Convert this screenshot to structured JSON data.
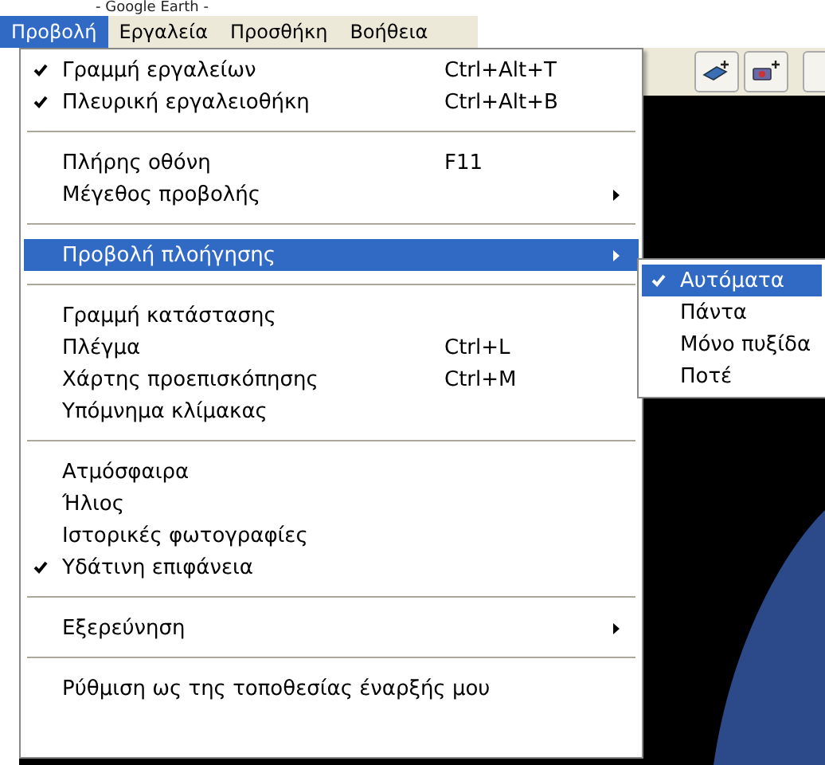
{
  "window": {
    "title": "- Google Earth -"
  },
  "menubar": [
    {
      "label": "Προβολή",
      "selected": true
    },
    {
      "label": "Εργαλεία",
      "selected": false
    },
    {
      "label": "Προσθήκη",
      "selected": false
    },
    {
      "label": "Βοήθεια",
      "selected": false
    }
  ],
  "menu": {
    "items": [
      {
        "kind": "item",
        "label": "Γραμμή εργαλείων",
        "shortcut": "Ctrl+Alt+T",
        "checked": true,
        "selected": false,
        "submenu": false
      },
      {
        "kind": "item",
        "label": "Πλευρική εργαλειοθήκη",
        "shortcut": "Ctrl+Alt+B",
        "checked": true,
        "selected": false,
        "submenu": false
      },
      {
        "kind": "separator"
      },
      {
        "kind": "item",
        "label": "Πλήρης οθόνη",
        "shortcut": "F11",
        "checked": false,
        "selected": false,
        "submenu": false
      },
      {
        "kind": "item",
        "label": "Μέγεθος προβολής",
        "checked": false,
        "selected": false,
        "submenu": true
      },
      {
        "kind": "separator"
      },
      {
        "kind": "item",
        "label": "Προβολή πλοήγησης",
        "checked": false,
        "selected": true,
        "submenu": true
      },
      {
        "kind": "separator"
      },
      {
        "kind": "item",
        "label": "Γραμμή κατάστασης",
        "checked": false,
        "selected": false,
        "submenu": false
      },
      {
        "kind": "item",
        "label": "Πλέγμα",
        "shortcut": "Ctrl+L",
        "checked": false,
        "selected": false,
        "submenu": false
      },
      {
        "kind": "item",
        "label": "Χάρτης προεπισκόπησης",
        "shortcut": "Ctrl+M",
        "checked": false,
        "selected": false,
        "submenu": false
      },
      {
        "kind": "item",
        "label": "Υπόμνημα κλίμακας",
        "checked": false,
        "selected": false,
        "submenu": false
      },
      {
        "kind": "separator"
      },
      {
        "kind": "item",
        "label": "Ατμόσφαιρα",
        "checked": false,
        "selected": false,
        "submenu": false
      },
      {
        "kind": "item",
        "label": "Ήλιος",
        "checked": false,
        "selected": false,
        "submenu": false
      },
      {
        "kind": "item",
        "label": "Ιστορικές φωτογραφίες",
        "checked": false,
        "selected": false,
        "submenu": false
      },
      {
        "kind": "item",
        "label": "Υδάτινη επιφάνεια",
        "checked": true,
        "selected": false,
        "submenu": false
      },
      {
        "kind": "separator"
      },
      {
        "kind": "item",
        "label": "Εξερεύνηση",
        "checked": false,
        "selected": false,
        "submenu": true
      },
      {
        "kind": "separator"
      },
      {
        "kind": "item",
        "label": "Ρύθμιση ως της τοποθεσίας έναρξής μου",
        "checked": false,
        "selected": false,
        "submenu": false
      }
    ]
  },
  "submenu": {
    "items": [
      {
        "label": "Αυτόματα",
        "checked": true,
        "selected": true
      },
      {
        "label": "Πάντα",
        "checked": false,
        "selected": false
      },
      {
        "label": "Μόνο πυξίδα",
        "checked": false,
        "selected": false
      },
      {
        "label": "Ποτέ",
        "checked": false,
        "selected": false
      }
    ]
  }
}
